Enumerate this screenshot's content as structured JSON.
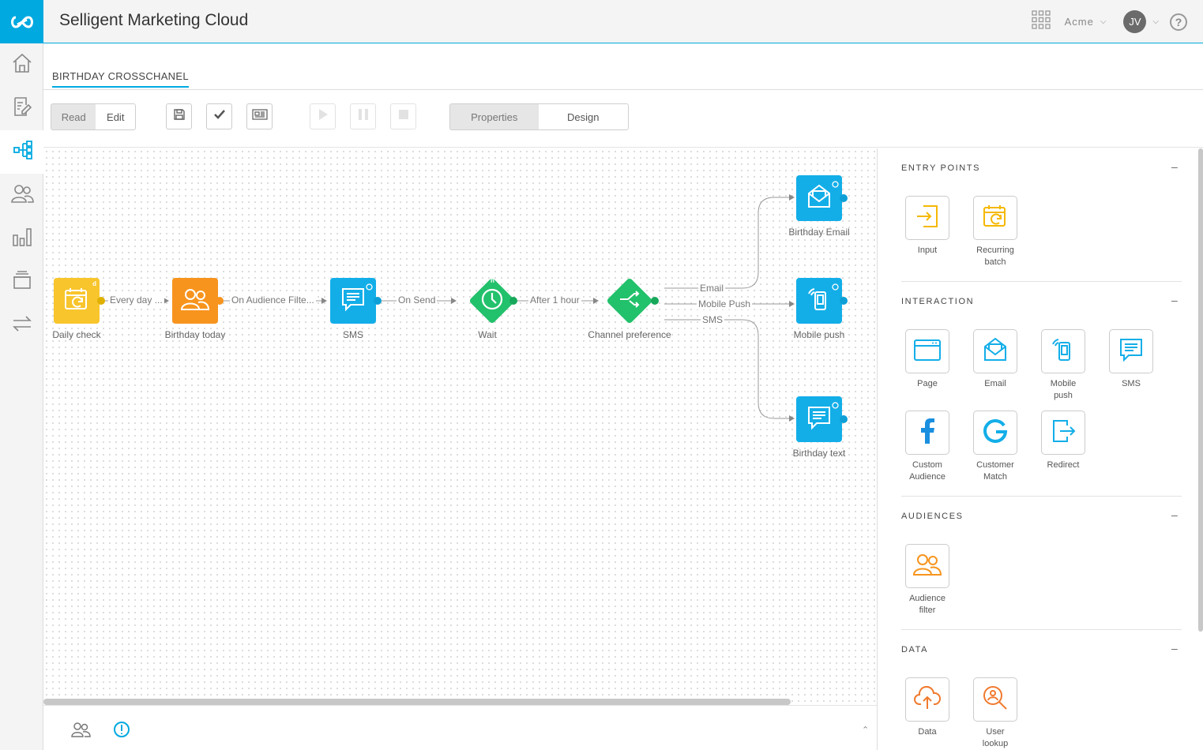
{
  "app": {
    "title": "Selligent Marketing Cloud",
    "org": "Acme",
    "user_initials": "JV",
    "help": "?"
  },
  "tab": {
    "label": "BIRTHDAY CROSSCHANEL"
  },
  "toolbar": {
    "read": "Read",
    "edit": "Edit",
    "properties": "Properties",
    "design": "Design"
  },
  "nodes": {
    "daily_check": {
      "label": "Daily check",
      "badge": "d"
    },
    "birthday_today": {
      "label": "Birthday today"
    },
    "sms": {
      "label": "SMS"
    },
    "wait": {
      "label": "Wait",
      "badge": "h"
    },
    "channel_pref": {
      "label": "Channel preference"
    },
    "birthday_email": {
      "label": "Birthday Email"
    },
    "mobile_push": {
      "label": "Mobile push"
    },
    "birthday_text": {
      "label": "Birthday text"
    }
  },
  "edges": {
    "every_day": "Every day ...",
    "on_audience": "On Audience Filte...",
    "on_send": "On Send",
    "after_hour": "After 1 hour",
    "email": "Email",
    "mobile_push": "Mobile Push",
    "sms": "SMS"
  },
  "panel": {
    "entry_points": {
      "title": "ENTRY POINTS",
      "items": [
        "Input",
        "Recurring\nbatch"
      ]
    },
    "interaction": {
      "title": "INTERACTION",
      "items": [
        "Page",
        "Email",
        "Mobile\npush",
        "SMS",
        "Custom\nAudience",
        "Customer\nMatch",
        "Redirect"
      ]
    },
    "audiences": {
      "title": "AUDIENCES",
      "items": [
        "Audience\nfilter"
      ]
    },
    "data": {
      "title": "DATA",
      "items": [
        "Data",
        "User\nlookup"
      ]
    },
    "collapse": "–"
  },
  "colors": {
    "accent": "#00a9e0",
    "yellow": "#f8c52c",
    "orange": "#f7941d",
    "green": "#22c16b",
    "entry": "#f5b800",
    "fb": "#1a8fe0"
  }
}
